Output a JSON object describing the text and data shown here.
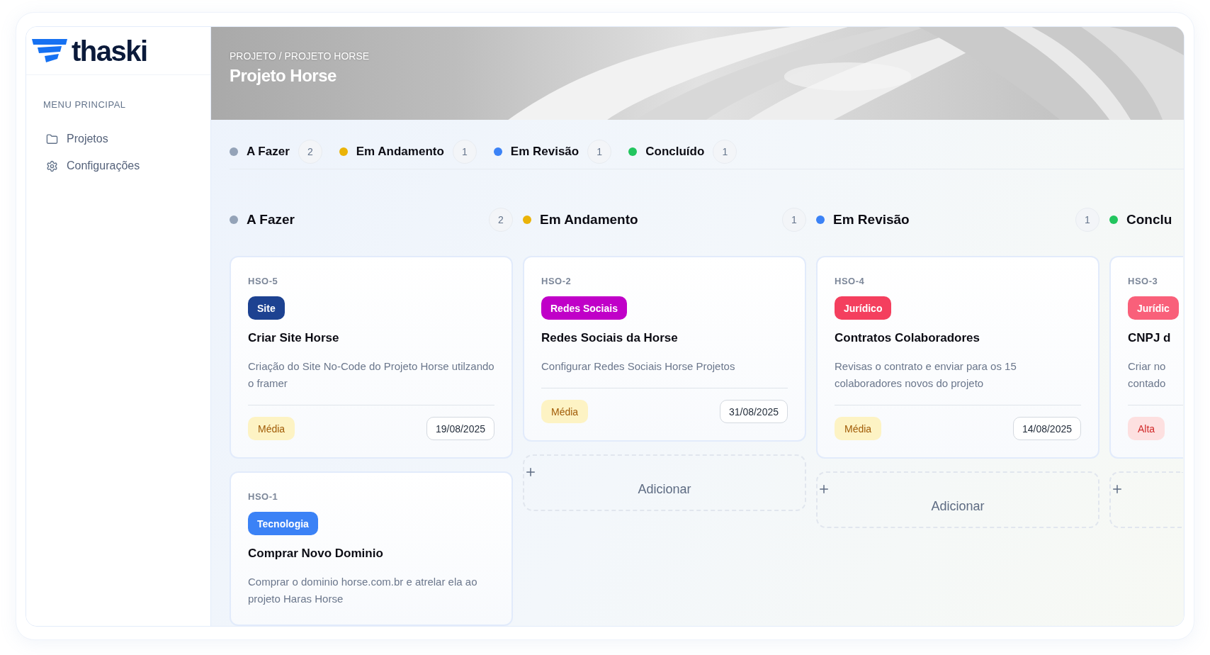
{
  "logo": {
    "text": "thaski"
  },
  "sidebar": {
    "section_title": "MENU PRINCIPAL",
    "items": [
      {
        "label": "Projetos",
        "kind": "folder"
      },
      {
        "label": "Configurações",
        "kind": "settings"
      }
    ]
  },
  "header": {
    "kind": "picture",
    "breadcrumb": "PROJETO / PROJETO HORSE",
    "title": "Projeto Horse"
  },
  "status_summary": [
    {
      "label": "A Fazer",
      "count": "2",
      "color": "#94a3b8"
    },
    {
      "label": "Em Andamento",
      "count": "1",
      "color": "#eab308"
    },
    {
      "label": "Em Revisão",
      "count": "1",
      "color": "#3b82f6"
    },
    {
      "label": "Concluído",
      "count": "1",
      "color": "#22c55e"
    }
  ],
  "columns": [
    {
      "title": "A Fazer",
      "count": "2",
      "color": "#94a3b8",
      "partial": false,
      "cards": [
        {
          "id": "HSO-5",
          "tag": {
            "label": "Site",
            "color": "#1d4291"
          },
          "title": "Criar Site Horse",
          "description": "Criação do Site No-Code do Projeto Horse utilzando o framer",
          "priority": {
            "label": "Média",
            "kind": "medium"
          },
          "date": "19/08/2025"
        },
        {
          "id": "HSO-1",
          "tag": {
            "label": "Tecnologia",
            "color": "#3b82f6"
          },
          "title": "Comprar Novo Dominio",
          "description": "Comprar o dominio horse.com.br e atrelar ela ao projeto Haras Horse"
        }
      ]
    },
    {
      "title": "Em Andamento",
      "count": "1",
      "color": "#eab308",
      "partial": false,
      "has_add": true,
      "add_label": "Adicionar",
      "cards": [
        {
          "id": "HSO-2",
          "tag": {
            "label": "Redes Sociais",
            "color": "#c000c8"
          },
          "title": "Redes Sociais da Horse",
          "description": "Configurar Redes Sociais Horse Projetos",
          "priority": {
            "label": "Média",
            "kind": "medium"
          },
          "date": "31/08/2025"
        }
      ]
    },
    {
      "title": "Em Revisão",
      "count": "1",
      "color": "#3b82f6",
      "partial": false,
      "has_add": true,
      "add_label": "Adicionar",
      "cards": [
        {
          "id": "HSO-4",
          "tag": {
            "label": "Jurídico",
            "color": "#f43f5e"
          },
          "title": "Contratos Colaboradores",
          "description": "Revisas o contrato e enviar para os 15 colaboradores novos do projeto",
          "priority": {
            "label": "Média",
            "kind": "medium"
          },
          "date": "14/08/2025"
        }
      ]
    },
    {
      "title": "Conclu",
      "color": "#22c55e",
      "partial": true,
      "has_add": true,
      "cards": [
        {
          "id": "HSO-3",
          "tag": {
            "label": "Jurídic",
            "color": "#f9607a"
          },
          "title": "CNPJ d",
          "description": "Criar no contado",
          "priority": {
            "label": "Alta",
            "kind": "high"
          }
        }
      ]
    }
  ]
}
